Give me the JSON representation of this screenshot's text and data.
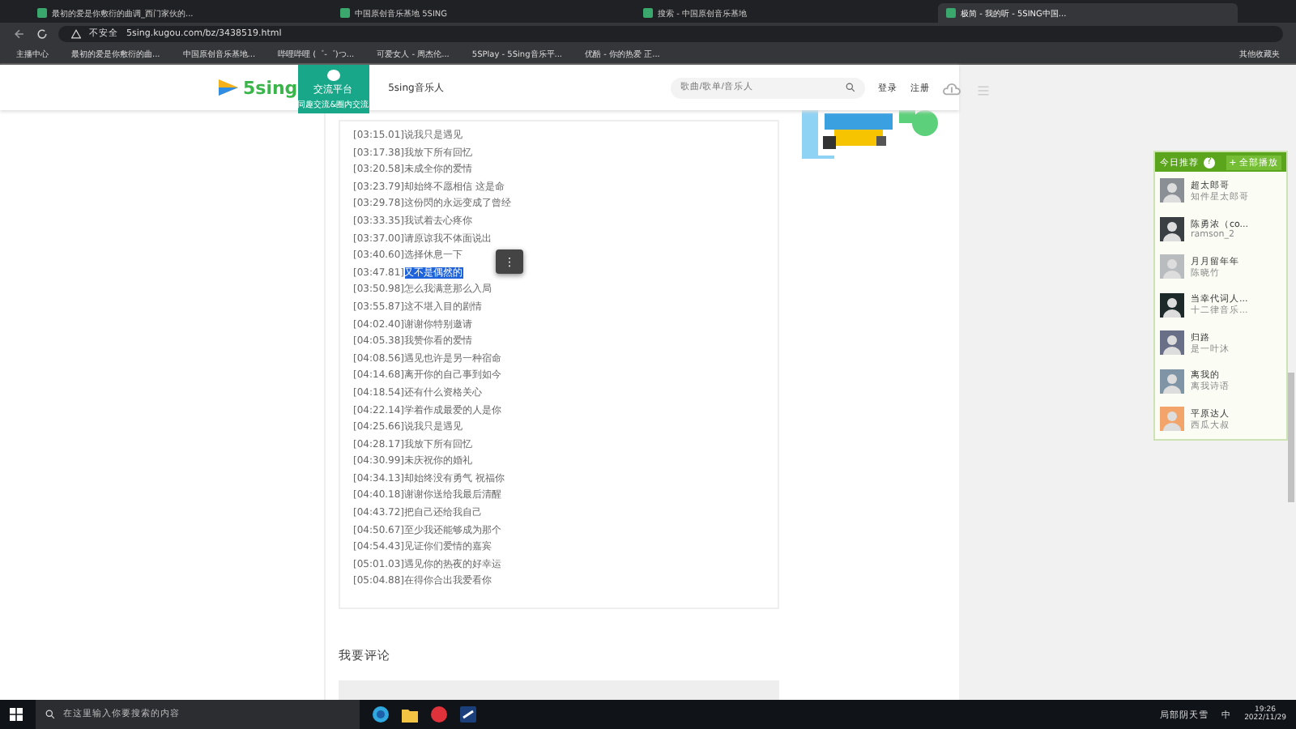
{
  "browser": {
    "tabs": [
      {
        "title": "最初的爱是你敷衍的曲调_西门家伙的...",
        "selected": false
      },
      {
        "title": "中国原创音乐基地 5SING",
        "selected": false
      },
      {
        "title": "搜索 - 中国原创音乐基地",
        "selected": false
      },
      {
        "title": "极简 - 我的听 - 5SING中国...",
        "selected": true
      }
    ],
    "security": "不安全",
    "url": "5sing.kugou.com/bz/3438519.html",
    "bookmarks": [
      "主播中心",
      "最初的爱是你敷衍的曲...",
      "中国原创音乐基地...",
      "哔哩哔哩 (゜-゜)つ...",
      "可爱女人 - 周杰伦...",
      "5SPlay - 5Sing音乐平...",
      "优酷 - 你的热爱 正..."
    ],
    "other_bookmarks": "其他收藏夹"
  },
  "header": {
    "logo": "5sing",
    "platform_title": "交流平台",
    "platform_subtitle": "同趣交流&圈内交流",
    "musician_link": "5sing音乐人",
    "search_placeholder": "歌曲/歌单/音乐人",
    "login": "登录",
    "register": "注册"
  },
  "lyrics": {
    "lines": [
      {
        "time": "[03:15.01]",
        "text": "说我只是遇见",
        "highlighted": false
      },
      {
        "time": "[03:17.38]",
        "text": "我放下所有回忆",
        "highlighted": false
      },
      {
        "time": "[03:20.58]",
        "text": "未成全你的爱情",
        "highlighted": false
      },
      {
        "time": "[03:23.79]",
        "text": "却始终不愿相信 这是命",
        "highlighted": false
      },
      {
        "time": "[03:29.78]",
        "text": "这份閃的永远变成了曾经",
        "highlighted": false
      },
      {
        "time": "[03:33.35]",
        "text": "我试着去心疼你",
        "highlighted": false
      },
      {
        "time": "[03:37.00]",
        "text": "请原谅我不体面说出",
        "highlighted": false
      },
      {
        "time": "[03:40.60]",
        "text": "选择休息一下",
        "highlighted": false
      },
      {
        "time": "[03:47.81]",
        "text": "又不是偶然的",
        "highlighted": true
      },
      {
        "time": "[03:50.98]",
        "text": "怎么我满意那么入局",
        "highlighted": false
      },
      {
        "time": "[03:55.87]",
        "text": "这不堪入目的剧情",
        "highlighted": false
      },
      {
        "time": "[04:02.40]",
        "text": "谢谢你特别邀请",
        "highlighted": false
      },
      {
        "time": "[04:05.38]",
        "text": "我赞你看的爱情",
        "highlighted": false
      },
      {
        "time": "[04:08.56]",
        "text": "遇见也许是另一种宿命",
        "highlighted": false
      },
      {
        "time": "[04:14.68]",
        "text": "离开你的自己事到如今",
        "highlighted": false
      },
      {
        "time": "[04:18.54]",
        "text": "还有什么资格关心",
        "highlighted": false
      },
      {
        "time": "[04:22.14]",
        "text": "学着作成最爱的人是你",
        "highlighted": false
      },
      {
        "time": "[04:25.66]",
        "text": "说我只是遇见",
        "highlighted": false
      },
      {
        "time": "[04:28.17]",
        "text": "我放下所有回忆",
        "highlighted": false
      },
      {
        "time": "[04:30.99]",
        "text": "未庆祝你的婚礼",
        "highlighted": false
      },
      {
        "time": "[04:34.13]",
        "text": "却始终没有勇气 祝福你",
        "highlighted": false
      },
      {
        "time": "[04:40.18]",
        "text": "谢谢你送给我最后清醒",
        "highlighted": false
      },
      {
        "time": "[04:43.72]",
        "text": "把自己还给我自己",
        "highlighted": false
      },
      {
        "time": "[04:50.67]",
        "text": "至少我还能够成为那个",
        "highlighted": false
      },
      {
        "time": "[04:54.43]",
        "text": "见证你们爱情的嘉宾",
        "highlighted": false
      },
      {
        "time": "[05:01.03]",
        "text": "遇见你的热夜的好幸运",
        "highlighted": false
      },
      {
        "time": "[05:04.88]",
        "text": "在得你合出我爱看你",
        "highlighted": false
      }
    ],
    "menu_glyph": "⋮"
  },
  "comments": {
    "title": "我要评论"
  },
  "recommend": {
    "title": "今日推荐",
    "help": "?",
    "play_all": "+ 全部播放",
    "items": [
      {
        "name": "超太郎哥",
        "subtitle": "知件星太郎哥",
        "color": "#8a8f96"
      },
      {
        "name": "陈勇浓（co...",
        "subtitle": "ramson_2",
        "color": "#3a3f44"
      },
      {
        "name": "月月留年年",
        "subtitle": "陈晓竹",
        "color": "#b9bcbf"
      },
      {
        "name": "当幸代词人...",
        "subtitle": "十二律音乐...",
        "color": "#1e2a2a"
      },
      {
        "name": "归路",
        "subtitle": "是一叶沐",
        "color": "#6a6f88"
      },
      {
        "name": "离我的",
        "subtitle": "离我诗语",
        "color": "#7f95a5"
      },
      {
        "name": "平原达人",
        "subtitle": "西瓜大叔",
        "color": "#f2a46a"
      }
    ]
  },
  "taskbar": {
    "search_placeholder": "在这里输入你要搜索的内容",
    "weather": "局部阴天雪",
    "ime": "中",
    "time": "19:26",
    "date": "2022/11/29"
  }
}
